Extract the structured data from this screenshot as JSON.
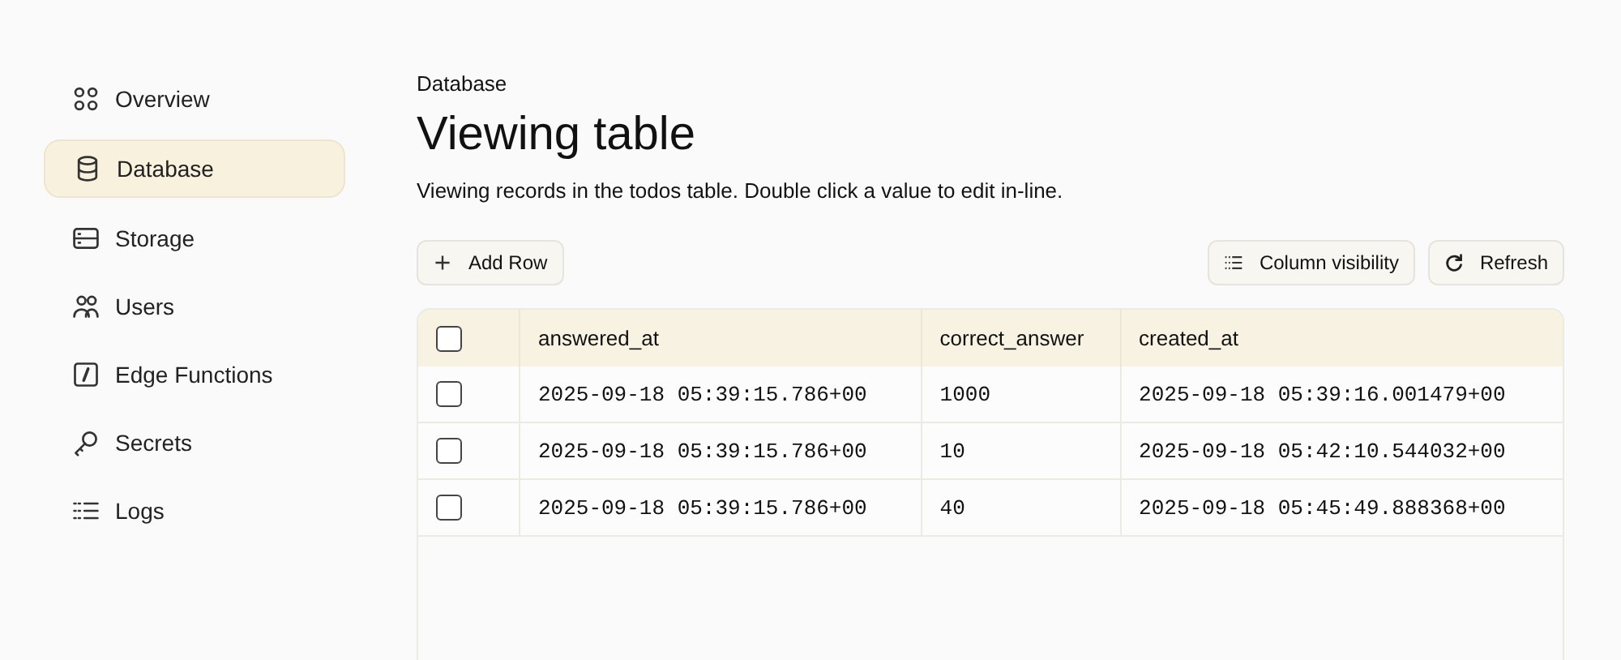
{
  "sidebar": {
    "items": [
      {
        "label": "Overview",
        "selected": false
      },
      {
        "label": "Database",
        "selected": true
      },
      {
        "label": "Storage",
        "selected": false
      },
      {
        "label": "Users",
        "selected": false
      },
      {
        "label": "Edge Functions",
        "selected": false
      },
      {
        "label": "Secrets",
        "selected": false
      },
      {
        "label": "Logs",
        "selected": false
      }
    ]
  },
  "breadcrumb": "Database",
  "title": "Viewing table",
  "description": "Viewing records in the todos table. Double click a value to edit in-line.",
  "toolbar": {
    "add_button": "Add Row",
    "column_visibility_button": "Column visibility",
    "refresh_button": "Refresh"
  },
  "table": {
    "header_checked": false,
    "columns": [
      "answered_at",
      "correct_answer",
      "created_at"
    ],
    "rows": [
      {
        "checked": false,
        "cells": [
          "2025-09-18 05:39:15.786+00",
          "1000",
          "2025-09-18 05:39:16.001479+00"
        ]
      },
      {
        "checked": false,
        "cells": [
          "2025-09-18 05:39:15.786+00",
          "10",
          "2025-09-18 05:42:10.544032+00"
        ]
      },
      {
        "checked": false,
        "cells": [
          "2025-09-18 05:39:15.786+00",
          "40",
          "2025-09-18 05:45:49.888368+00"
        ]
      }
    ]
  }
}
